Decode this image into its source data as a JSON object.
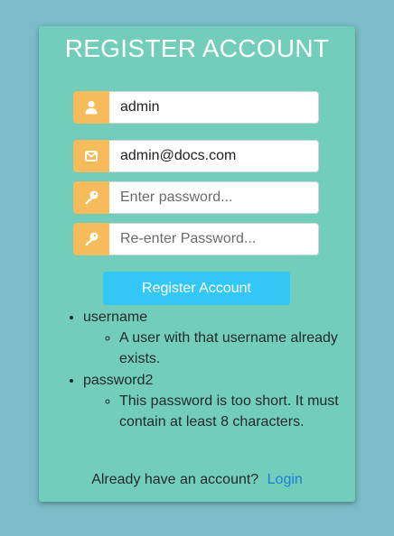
{
  "form": {
    "title": "REGISTER ACCOUNT",
    "fields": [
      {
        "name": "username",
        "icon": "user-icon",
        "value": "admin",
        "placeholder": ""
      },
      {
        "name": "email",
        "icon": "envelope-icon",
        "value": "admin@docs.com",
        "placeholder": ""
      },
      {
        "name": "password",
        "icon": "key-icon",
        "value": "",
        "placeholder": "Enter password..."
      },
      {
        "name": "password2",
        "icon": "key-icon",
        "value": "",
        "placeholder": "Re-enter Password..."
      }
    ],
    "submit_label": "Register Account"
  },
  "errors": [
    {
      "field": "username",
      "messages": [
        "A user with that username already exists."
      ]
    },
    {
      "field": "password2",
      "messages": [
        "This password is too short. It must contain at least 8 characters."
      ]
    }
  ],
  "footer": {
    "text": "Already have an account?",
    "login_label": "Login"
  },
  "colors": {
    "page_background": "#7bbcc8",
    "card_background": "#72cdbb",
    "icon_addon": "#f6bb5a",
    "button": "#33c7f5",
    "link": "#1a7fd6"
  }
}
